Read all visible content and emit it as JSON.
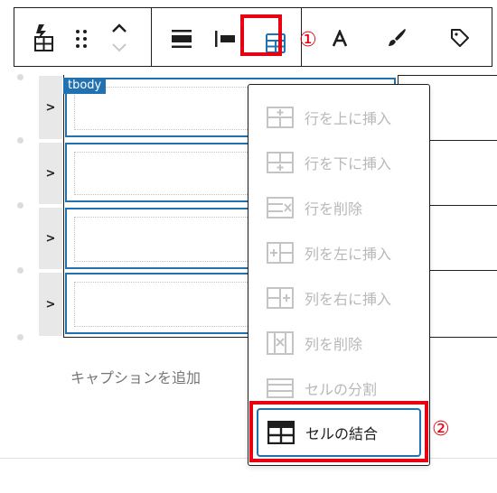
{
  "toolbar": {
    "icons": [
      "transform-table-icon",
      "drag-handle-icon",
      "move-up-icon",
      "move-down-icon",
      "align-wide-icon",
      "align-left-icon",
      "edit-table-icon",
      "typography-icon",
      "brush-icon",
      "tag-icon"
    ],
    "annotation_1": "①"
  },
  "editor": {
    "section_tag": "tbody",
    "caption_placeholder": "キャプションを追加",
    "row_count": 4
  },
  "dropdown": {
    "items": [
      {
        "label": "行を上に挿入",
        "icon": "insert-row-above-icon",
        "enabled": false
      },
      {
        "label": "行を下に挿入",
        "icon": "insert-row-below-icon",
        "enabled": false
      },
      {
        "label": "行を削除",
        "icon": "delete-row-icon",
        "enabled": false
      },
      {
        "label": "列を左に挿入",
        "icon": "insert-column-left-icon",
        "enabled": false
      },
      {
        "label": "列を右に挿入",
        "icon": "insert-column-right-icon",
        "enabled": false
      },
      {
        "label": "列を削除",
        "icon": "delete-column-icon",
        "enabled": false
      },
      {
        "label": "セルの分割",
        "icon": "split-cell-icon",
        "enabled": false
      },
      {
        "label": "セルの結合",
        "icon": "merge-cells-icon",
        "enabled": true
      }
    ],
    "annotation_2": "②"
  },
  "colors": {
    "highlight": "#e60012",
    "accent": "#2271b1",
    "disabled": "#b8b8b8"
  }
}
